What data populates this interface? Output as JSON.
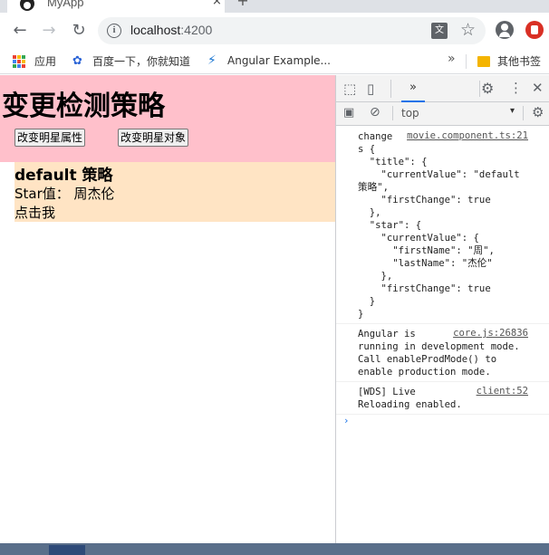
{
  "tab": {
    "title": "MyApp",
    "close": "×",
    "new_tab": "+"
  },
  "toolbar": {
    "back": "←",
    "forward": "→",
    "reload": "↻",
    "info_icon": "i",
    "url_host": "localhost",
    "url_port": ":4200",
    "translate_icon": "文",
    "star_icon": "☆"
  },
  "bookmarks": {
    "apps": "应用",
    "baidu": "百度一下，你就知道",
    "angular": "Angular Example...",
    "more": "»",
    "other": "其他书签"
  },
  "page": {
    "title": "变更检测策略",
    "btn_change_property": "改变明星属性",
    "btn_change_object": "改变明星对象",
    "child_title": "default 策略",
    "star_label": "Star值：",
    "star_value": "周杰伦",
    "click_me": "点击我"
  },
  "devtools": {
    "more_tabs": "»",
    "context": "top",
    "messages": [
      {
        "source": "movie.component.ts:21",
        "lines": [
          "change",
          "s {",
          "  \"title\": {",
          "    \"currentValue\": \"default",
          "策略\",",
          "    \"firstChange\": true",
          "  },",
          "  \"star\": {",
          "    \"currentValue\": {",
          "      \"firstName\": \"周\",",
          "      \"lastName\": \"杰伦\"",
          "    },",
          "    \"firstChange\": true",
          "  }",
          "}"
        ]
      },
      {
        "source": "core.js:26836",
        "lines": [
          "Angular is",
          "running in development mode.",
          "Call enableProdMode() to",
          "enable production mode."
        ]
      },
      {
        "source": "client:52",
        "lines": [
          "[WDS] Live",
          "Reloading enabled."
        ]
      }
    ],
    "prompt": "›"
  },
  "colors": {
    "pink_bg": "#ffc0cb",
    "bisque_bg": "#ffe4c4"
  }
}
